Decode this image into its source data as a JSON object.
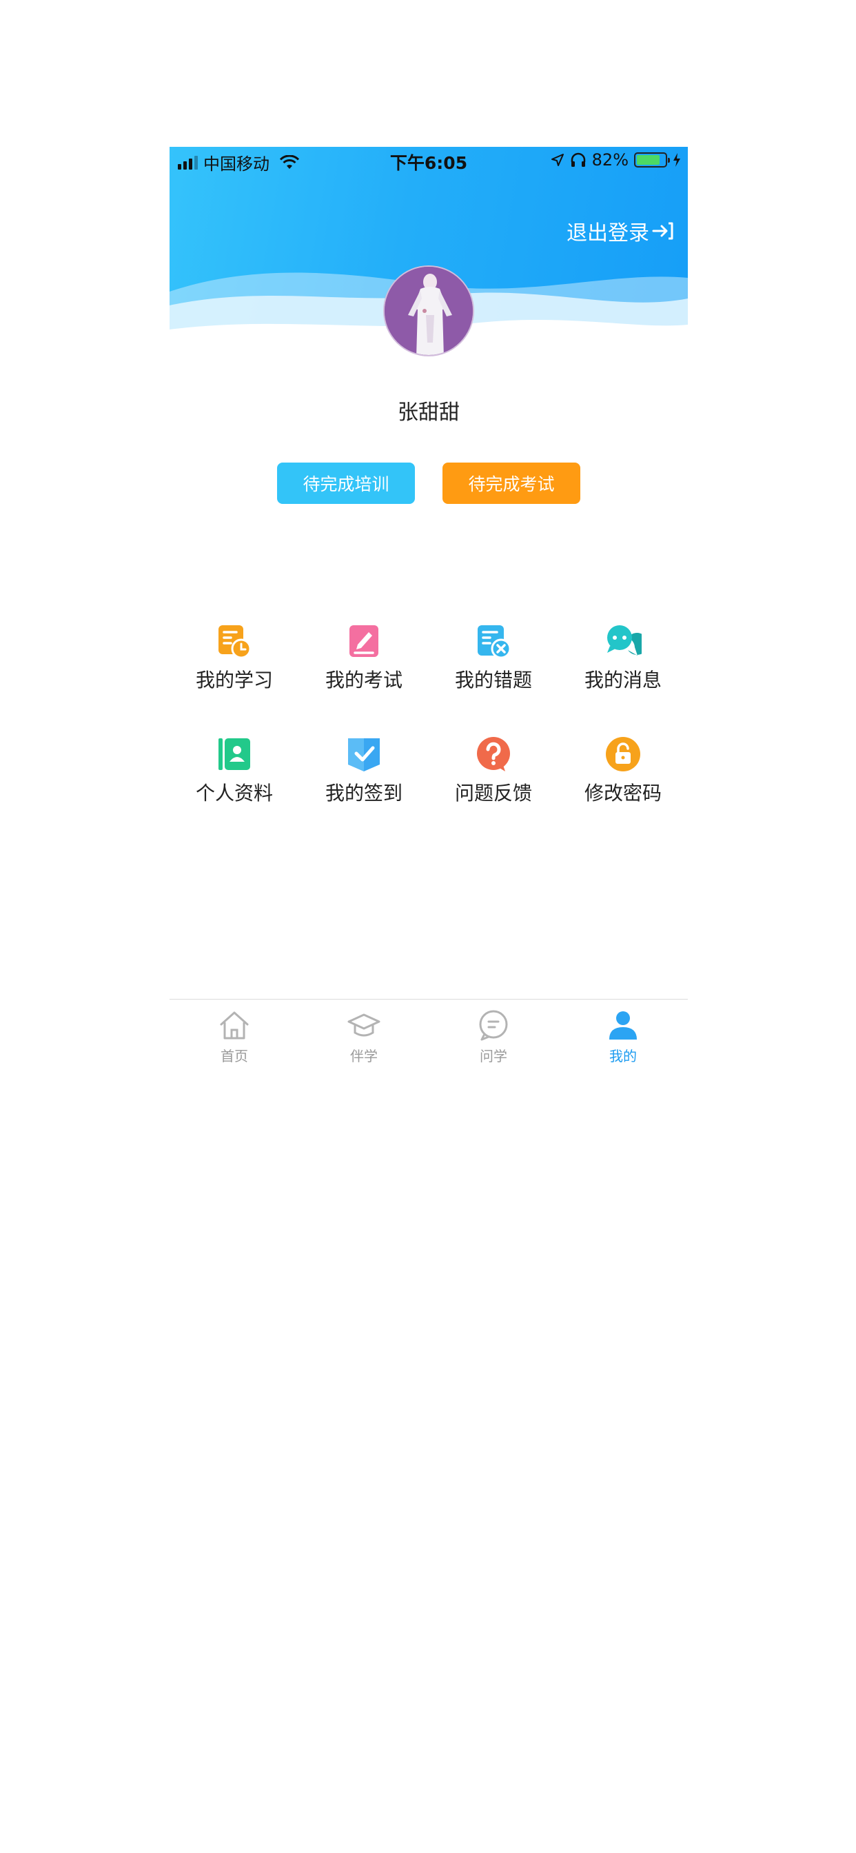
{
  "status_bar": {
    "carrier": "中国移动",
    "time": "下午6:05",
    "battery": "82%",
    "battery_level": 0.82
  },
  "header": {
    "logout_label": "退出登录",
    "logout_icon": "logout-arrow-icon"
  },
  "profile": {
    "username": "张甜甜",
    "avatar_icon": "avatar-photo"
  },
  "actions": {
    "training_label": "待完成培训",
    "exam_label": "待完成考试",
    "training_color": "#33c4f8",
    "exam_color": "#ff9b12"
  },
  "menu": [
    {
      "label": "我的学习",
      "icon": "study-clock-icon",
      "color": "#f7a21b"
    },
    {
      "label": "我的考试",
      "icon": "exam-pencil-icon",
      "color": "#f46fa0"
    },
    {
      "label": "我的错题",
      "icon": "wrong-answer-icon",
      "color": "#35b6ee"
    },
    {
      "label": "我的消息",
      "icon": "message-bubble-icon",
      "color": "#23c5c9"
    },
    {
      "label": "个人资料",
      "icon": "profile-card-icon",
      "color": "#22c98a"
    },
    {
      "label": "我的签到",
      "icon": "checkin-icon",
      "color": "#3aa7f2"
    },
    {
      "label": "问题反馈",
      "icon": "question-icon",
      "color": "#f06a4a"
    },
    {
      "label": "修改密码",
      "icon": "lock-icon",
      "color": "#f7a21b"
    }
  ],
  "tabbar": {
    "active_color": "#1c9bf0",
    "inactive_color": "#9a9a9a",
    "items": [
      {
        "label": "首页",
        "icon": "home-icon",
        "active": false
      },
      {
        "label": "伴学",
        "icon": "graduation-cap-icon",
        "active": false
      },
      {
        "label": "问学",
        "icon": "chat-icon",
        "active": false
      },
      {
        "label": "我的",
        "icon": "user-icon",
        "active": true
      }
    ]
  }
}
